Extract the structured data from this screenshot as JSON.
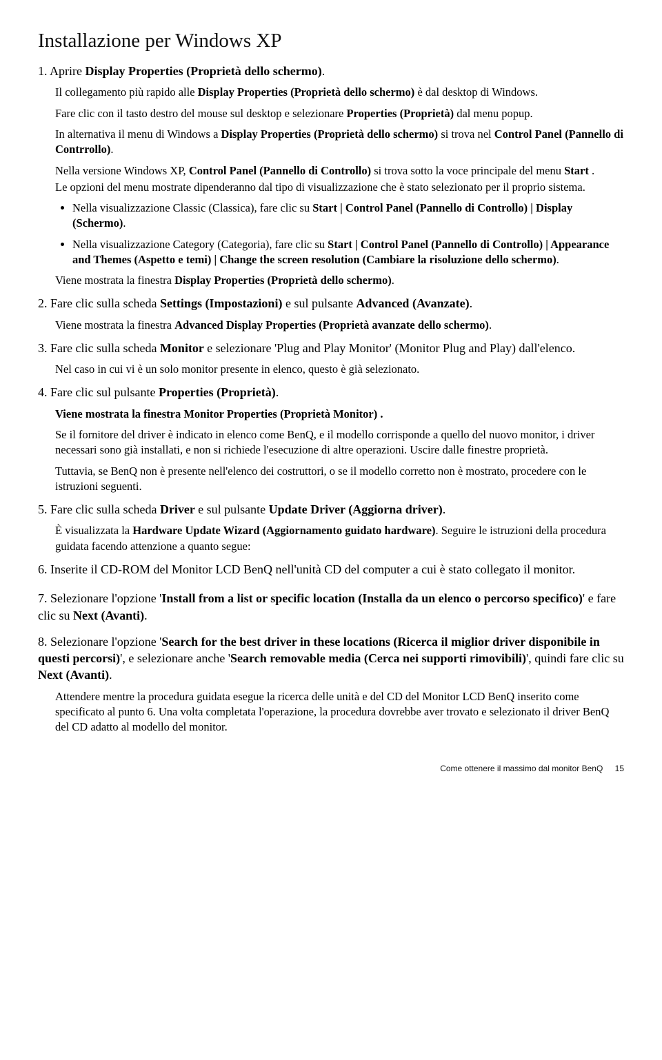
{
  "title": "Installazione per Windows XP",
  "s1": {
    "num": "1.",
    "lead": "Aprire ",
    "bold": "Display Properties (Proprietà dello schermo)",
    "tail": ".",
    "p1a": "Il collegamento più rapido alle ",
    "p1b": "Display Properties (Proprietà dello schermo) ",
    "p1c": "è dal desktop di Windows.",
    "p2a": "Fare clic con il tasto destro del mouse sul desktop e selezionare ",
    "p2b": "Properties (Proprietà) ",
    "p2c": "dal menu popup.",
    "p3a": "In alternativa il menu di Windows a ",
    "p3b": "Display Properties (Proprietà dello schermo) ",
    "p3c": "si trova nel ",
    "p3d": "Control Panel (Pannello di Contrrollo)",
    "p3e": ".",
    "p4a": "Nella versione Windows XP, ",
    "p4b": "Control Panel (Pannello di Controllo) ",
    "p4c": "si trova sotto la voce principale del menu ",
    "p4d": "Start ",
    "p4e": ".",
    "p5": "Le opzioni del menu mostrate dipenderanno dal tipo di visualizzazione che è stato selezionato per il proprio sistema.",
    "b1a": "Nella visualizzazione Classic (Classica), fare clic su ",
    "b1b": "Start | Control Panel (Pannello di Controllo) | Display (Schermo)",
    "b1c": ".",
    "b2a": "Nella visualizzazione Category (Categoria), fare clic su ",
    "b2b": "Start | Control Panel (Pannello di Controllo) | Appearance and Themes (Aspetto e temi) | Change the screen resolution (Cambiare la risoluzione dello schermo)",
    "b2c": ".",
    "p6a": "Viene mostrata la finestra ",
    "p6b": "Display Properties (Proprietà dello schermo)",
    "p6c": "."
  },
  "s2": {
    "num": "2.",
    "a": "Fare clic sulla scheda ",
    "b": "Settings (Impostazioni) ",
    "c": "e sul pulsante ",
    "d": "Advanced (Avanzate)",
    "e": ".",
    "p1a": "Viene mostrata la finestra ",
    "p1b": "Advanced Display Properties (Proprietà avanzate dello schermo)",
    "p1c": "."
  },
  "s3": {
    "num": "3.",
    "a": "Fare clic sulla scheda ",
    "b": "Monitor ",
    "c": "e selezionare 'Plug and Play Monitor' (Monitor Plug and Play) dall'elenco.",
    "p1": "Nel caso in cui vi è un solo monitor presente in elenco, questo è già selezionato."
  },
  "s4": {
    "num": "4.",
    "a": "Fare clic sul pulsante ",
    "b": "Properties (Proprietà)",
    "c": ".",
    "p1": "Viene mostrata la finestra Monitor Properties (Proprietà Monitor) .",
    "p2": "Se il fornitore del driver è indicato in elenco come BenQ, e il modello corrisponde a quello del nuovo monitor, i driver necessari sono già installati, e non si richiede l'esecuzione di altre operazioni. Uscire dalle finestre proprietà.",
    "p3": "Tuttavia, se BenQ non è presente nell'elenco dei costruttori, o se il modello corretto non è mostrato, procedere con le istruzioni seguenti."
  },
  "s5": {
    "num": "5.",
    "a": "Fare clic sulla scheda ",
    "b": "Driver ",
    "c": "e sul pulsante ",
    "d": "Update Driver (Aggiorna driver)",
    "e": ".",
    "p1a": "È visualizzata la ",
    "p1b": "Hardware Update Wizard (Aggiornamento guidato hardware)",
    "p1c": ". Seguire le istruzioni della procedura guidata facendo attenzione a quanto segue:"
  },
  "s6": {
    "num": "6.",
    "a": "Inserite il CD-ROM del Monitor LCD BenQ nell'unità CD del computer a cui è stato collegato il monitor."
  },
  "s7": {
    "num": "7.",
    "a": "Selezionare l'opzione '",
    "b": "Install from a list or specific location (Installa da un elenco o percorso specifico)",
    "c": "' e fare clic su ",
    "d": "Next (Avanti)",
    "e": "."
  },
  "s8": {
    "num": "8.",
    "a": "Selezionare l'opzione '",
    "b": "Search for the best driver in these locations (Ricerca il miglior driver disponibile in questi percorsi)",
    "c": "', e selezionare anche '",
    "d": "Search removable media (Cerca nei supporti rimovibili)",
    "e": "', quindi fare clic su ",
    "f": "Next (Avanti)",
    "g": ".",
    "p1": "Attendere mentre la procedura guidata esegue la ricerca delle unità e del CD del Monitor LCD BenQ inserito come specificato al punto 6. Una volta completata l'operazione, la procedura dovrebbe aver trovato e selezionato il driver BenQ del CD adatto al modello del monitor."
  },
  "footer": {
    "text": "Come ottenere il massimo dal monitor BenQ",
    "page": "15"
  }
}
